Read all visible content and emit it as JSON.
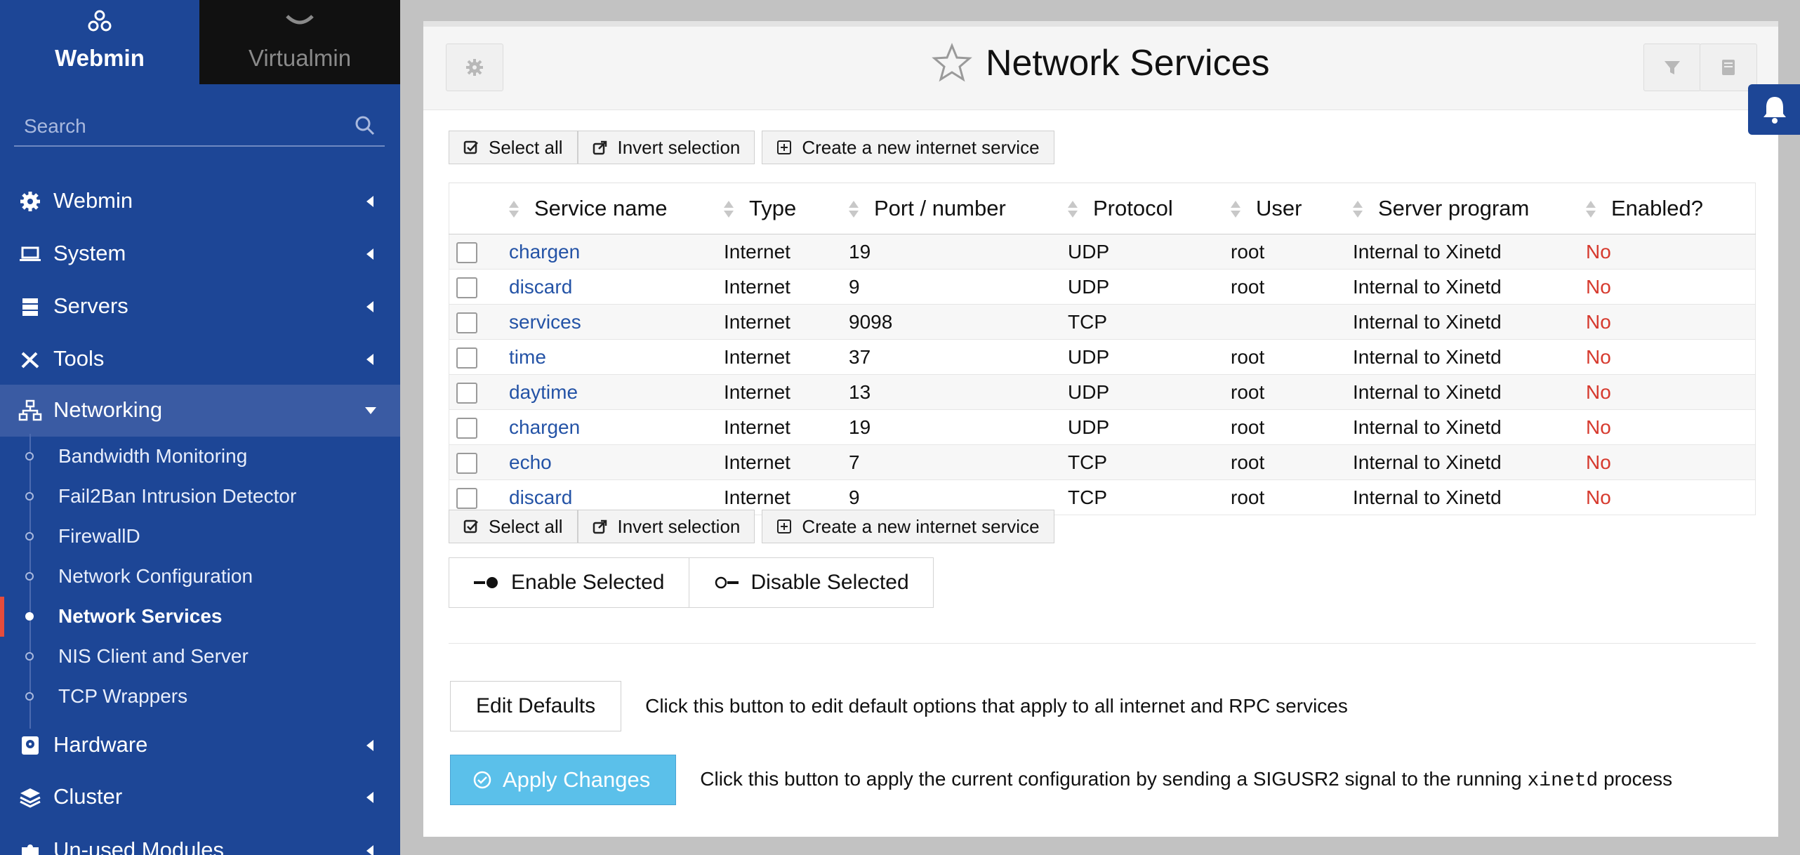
{
  "brand": {
    "webmin": "Webmin",
    "virtualmin": "Virtualmin"
  },
  "search": {
    "placeholder": "Search"
  },
  "menu": {
    "webmin": "Webmin",
    "system": "System",
    "servers": "Servers",
    "tools": "Tools",
    "networking": "Networking",
    "hardware": "Hardware",
    "cluster": "Cluster",
    "unused": "Un-used Modules"
  },
  "networking_items": [
    "Bandwidth Monitoring",
    "Fail2Ban Intrusion Detector",
    "FirewallD",
    "Network Configuration",
    "Network Services",
    "NIS Client and Server",
    "TCP Wrappers"
  ],
  "page": {
    "title": "Network Services"
  },
  "actions": {
    "select_all": "Select all",
    "invert": "Invert selection",
    "create": "Create a new internet service",
    "enable_selected": "Enable Selected",
    "disable_selected": "Disable Selected",
    "edit_defaults": "Edit Defaults",
    "edit_defaults_desc": "Click this button to edit default options that apply to all internet and RPC services",
    "apply_changes": "Apply Changes",
    "apply_desc_pre": "Click this button to apply the current configuration by sending a SIGUSR2 signal to the running",
    "apply_desc_code": "xinetd",
    "apply_desc_post": "process"
  },
  "table": {
    "headers": [
      "Service name",
      "Type",
      "Port / number",
      "Protocol",
      "User",
      "Server program",
      "Enabled?"
    ],
    "rows": [
      [
        "chargen",
        "Internet",
        "19",
        "UDP",
        "root",
        "Internal to Xinetd",
        "No"
      ],
      [
        "discard",
        "Internet",
        "9",
        "UDP",
        "root",
        "Internal to Xinetd",
        "No"
      ],
      [
        "services",
        "Internet",
        "9098",
        "TCP",
        "",
        "Internal to Xinetd",
        "No"
      ],
      [
        "time",
        "Internet",
        "37",
        "UDP",
        "root",
        "Internal to Xinetd",
        "No"
      ],
      [
        "daytime",
        "Internet",
        "13",
        "UDP",
        "root",
        "Internal to Xinetd",
        "No"
      ],
      [
        "chargen",
        "Internet",
        "19",
        "UDP",
        "root",
        "Internal to Xinetd",
        "No"
      ],
      [
        "echo",
        "Internet",
        "7",
        "TCP",
        "root",
        "Internal to Xinetd",
        "No"
      ],
      [
        "discard",
        "Internet",
        "9",
        "TCP",
        "root",
        "Internal to Xinetd",
        "No"
      ]
    ]
  },
  "colors": {
    "sidebar": "#1d4696",
    "accent_red": "#d63a2e",
    "link": "#2453a6",
    "apply": "#5bc0ea"
  }
}
